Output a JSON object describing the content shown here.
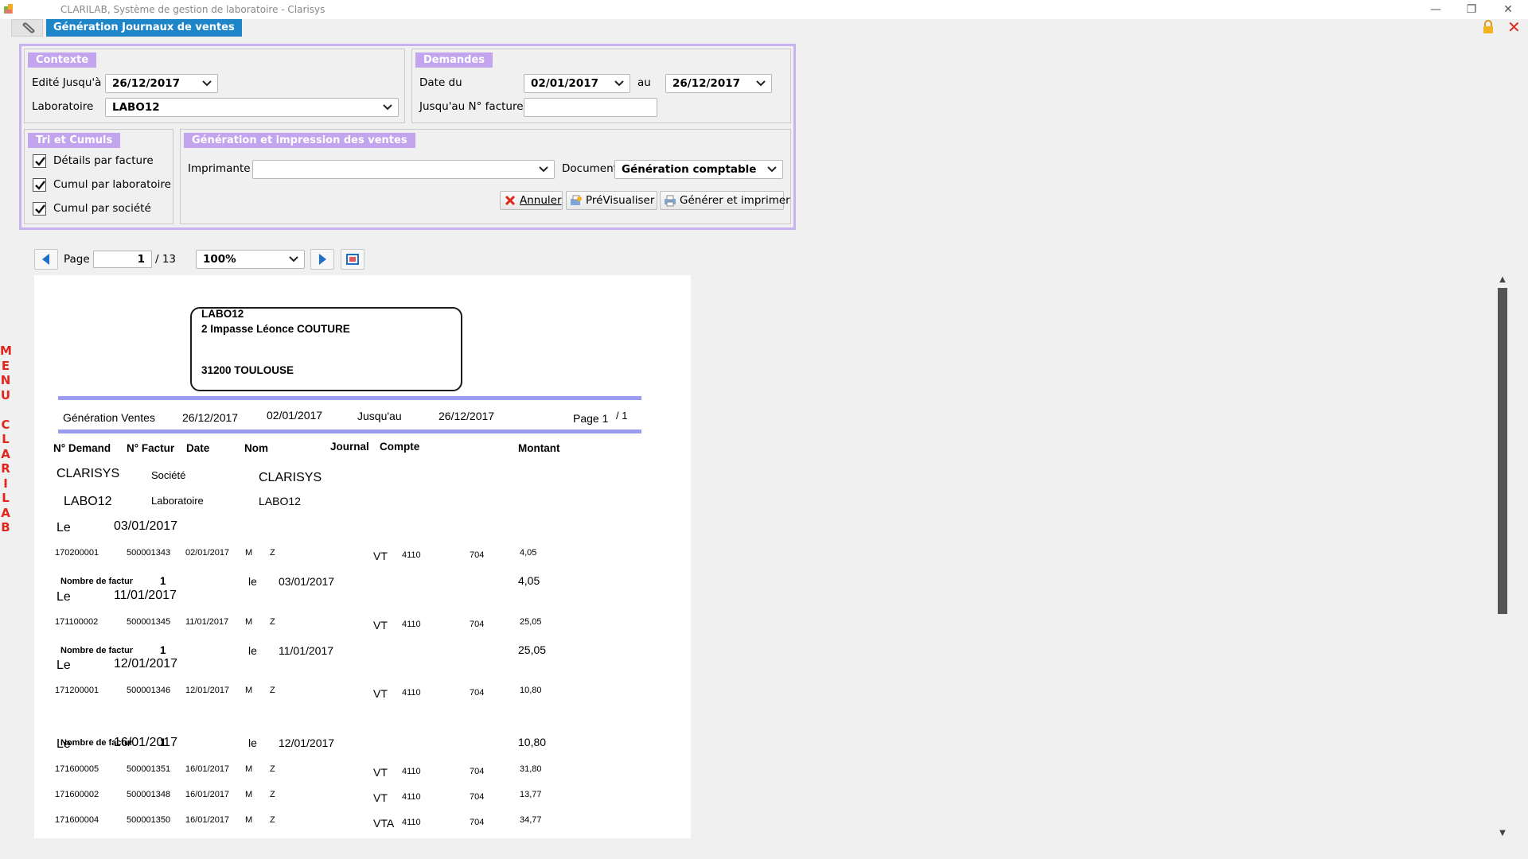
{
  "window": {
    "title": "CLARILAB, Système de gestion de laboratoire - Clarisys"
  },
  "tabs": {
    "active": "Génération Journaux de ventes"
  },
  "contexte": {
    "title": "Contexte",
    "edite_label": "Edité Jusqu'à",
    "edite_value": "26/12/2017",
    "labo_label": "Laboratoire",
    "labo_value": "LABO12"
  },
  "demandes": {
    "title": "Demandes",
    "date_du_label": "Date du",
    "date_du_value": "02/01/2017",
    "au_label": "au",
    "au_value": "26/12/2017",
    "facture_label": "Jusqu'au N° facture",
    "facture_value": ""
  },
  "tri": {
    "title": "Tri et Cumuls",
    "items": [
      {
        "label": "Détails par facture",
        "checked": true
      },
      {
        "label": "Cumul par laboratoire",
        "checked": true
      },
      {
        "label": "Cumul par société",
        "checked": true
      }
    ]
  },
  "generation": {
    "title": "Génération et impression des ventes",
    "imprimante_label": "Imprimante",
    "imprimante_value": "",
    "document_label": "Document",
    "document_value": "Génération comptable",
    "annuler": "Annuler",
    "previsualiser": "PréVisualiser",
    "generer": "Générer et imprimer"
  },
  "preview": {
    "page_label": "Page",
    "page_value": "1",
    "page_total": "/ 13",
    "zoom": "100%"
  },
  "side_menu": [
    "M",
    "E",
    "N",
    "U",
    "",
    "C",
    "L",
    "A",
    "R",
    "I",
    "L",
    "A",
    "B"
  ],
  "report": {
    "addr_name": "LABO12",
    "addr_street": "2 Impasse Léonce COUTURE",
    "addr_city": "31200 TOULOUSE",
    "header": {
      "title": "Génération Ventes",
      "edit_date": "26/12/2017",
      "from": "02/01/2017",
      "jusquau": "Jusqu'au",
      "to": "26/12/2017",
      "page": "Page 1",
      "page_of": "/ 1"
    },
    "columns": {
      "demand": "N° Demand",
      "factur": "N° Factur",
      "date": "Date",
      "nom": "Nom",
      "journal": "Journal",
      "compte": "Compte",
      "montant": "Montant"
    },
    "societe_name": "CLARISYS",
    "societe_label": "Société",
    "societe_value": "CLARISYS",
    "labo_name": "LABO12",
    "labo_label": "Laboratoire",
    "labo_value": "LABO12",
    "le": "Le",
    "le_lower": "le",
    "nb_label": "Nombre de factur",
    "groups": [
      {
        "date": "03/01/2017",
        "rows": [
          {
            "demand": "170200001",
            "factur": "500001343",
            "date": "02/01/2017",
            "c1": "M",
            "c2": "Z",
            "journal": "VT",
            "compte": "4110",
            "compte2": "704",
            "montant": "4,05"
          }
        ],
        "count": "1",
        "total_date": "03/01/2017",
        "total": "4,05"
      },
      {
        "date": "11/01/2017",
        "rows": [
          {
            "demand": "171100002",
            "factur": "500001345",
            "date": "11/01/2017",
            "c1": "M",
            "c2": "Z",
            "journal": "VT",
            "compte": "4110",
            "compte2": "704",
            "montant": "25,05"
          }
        ],
        "count": "1",
        "total_date": "11/01/2017",
        "total": "25,05"
      },
      {
        "date": "12/01/2017",
        "rows": [
          {
            "demand": "171200001",
            "factur": "500001346",
            "date": "12/01/2017",
            "c1": "M",
            "c2": "Z",
            "journal": "VT",
            "compte": "4110",
            "compte2": "704",
            "montant": "10,80"
          }
        ],
        "count": "1",
        "total_date": "12/01/2017",
        "total": "10,80"
      },
      {
        "date": "16/01/2017",
        "rows": [
          {
            "demand": "171600005",
            "factur": "500001351",
            "date": "16/01/2017",
            "c1": "M",
            "c2": "Z",
            "journal": "VT",
            "compte": "4110",
            "compte2": "704",
            "montant": "31,80"
          },
          {
            "demand": "171600002",
            "factur": "500001348",
            "date": "16/01/2017",
            "c1": "M",
            "c2": "Z",
            "journal": "VT",
            "compte": "4110",
            "compte2": "704",
            "montant": "13,77"
          },
          {
            "demand": "171600004",
            "factur": "500001350",
            "date": "16/01/2017",
            "c1": "M",
            "c2": "Z",
            "journal": "VTA",
            "compte": "4110",
            "compte2": "704",
            "montant": "34,77"
          }
        ]
      }
    ]
  },
  "colors": {
    "accent": "#1e86c8",
    "group_title": "#c3a4ee",
    "frame": "#c9b2f0",
    "rule": "#9b9bef",
    "menu": "#e0271e"
  }
}
